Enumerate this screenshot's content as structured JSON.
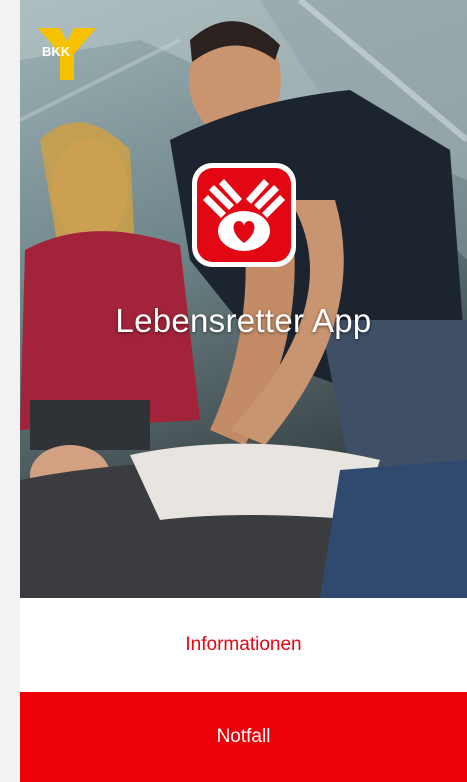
{
  "brand": {
    "logo_text": "BKK",
    "logo_color": "#f6c200"
  },
  "app": {
    "title": "Lebensretter App",
    "accent": "#e30613"
  },
  "actions": {
    "info_label": "Informationen",
    "emergency_label": "Notfall",
    "emergency_color": "#ec0009"
  },
  "icons": {
    "app_icon": "hands-heart-icon",
    "logo": "bkk-logo-icon"
  }
}
